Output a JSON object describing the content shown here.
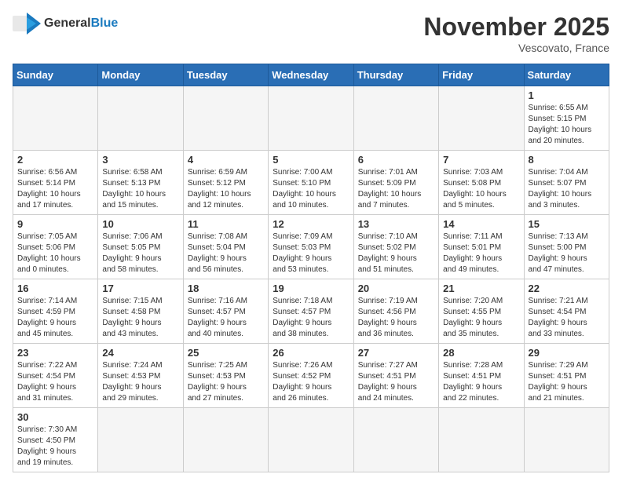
{
  "header": {
    "logo_text_normal": "General",
    "logo_text_blue": "Blue",
    "month_title": "November 2025",
    "location": "Vescovato, France"
  },
  "weekdays": [
    "Sunday",
    "Monday",
    "Tuesday",
    "Wednesday",
    "Thursday",
    "Friday",
    "Saturday"
  ],
  "weeks": [
    [
      {
        "day": "",
        "info": ""
      },
      {
        "day": "",
        "info": ""
      },
      {
        "day": "",
        "info": ""
      },
      {
        "day": "",
        "info": ""
      },
      {
        "day": "",
        "info": ""
      },
      {
        "day": "",
        "info": ""
      },
      {
        "day": "1",
        "info": "Sunrise: 6:55 AM\nSunset: 5:15 PM\nDaylight: 10 hours\nand 20 minutes."
      }
    ],
    [
      {
        "day": "2",
        "info": "Sunrise: 6:56 AM\nSunset: 5:14 PM\nDaylight: 10 hours\nand 17 minutes."
      },
      {
        "day": "3",
        "info": "Sunrise: 6:58 AM\nSunset: 5:13 PM\nDaylight: 10 hours\nand 15 minutes."
      },
      {
        "day": "4",
        "info": "Sunrise: 6:59 AM\nSunset: 5:12 PM\nDaylight: 10 hours\nand 12 minutes."
      },
      {
        "day": "5",
        "info": "Sunrise: 7:00 AM\nSunset: 5:10 PM\nDaylight: 10 hours\nand 10 minutes."
      },
      {
        "day": "6",
        "info": "Sunrise: 7:01 AM\nSunset: 5:09 PM\nDaylight: 10 hours\nand 7 minutes."
      },
      {
        "day": "7",
        "info": "Sunrise: 7:03 AM\nSunset: 5:08 PM\nDaylight: 10 hours\nand 5 minutes."
      },
      {
        "day": "8",
        "info": "Sunrise: 7:04 AM\nSunset: 5:07 PM\nDaylight: 10 hours\nand 3 minutes."
      }
    ],
    [
      {
        "day": "9",
        "info": "Sunrise: 7:05 AM\nSunset: 5:06 PM\nDaylight: 10 hours\nand 0 minutes."
      },
      {
        "day": "10",
        "info": "Sunrise: 7:06 AM\nSunset: 5:05 PM\nDaylight: 9 hours\nand 58 minutes."
      },
      {
        "day": "11",
        "info": "Sunrise: 7:08 AM\nSunset: 5:04 PM\nDaylight: 9 hours\nand 56 minutes."
      },
      {
        "day": "12",
        "info": "Sunrise: 7:09 AM\nSunset: 5:03 PM\nDaylight: 9 hours\nand 53 minutes."
      },
      {
        "day": "13",
        "info": "Sunrise: 7:10 AM\nSunset: 5:02 PM\nDaylight: 9 hours\nand 51 minutes."
      },
      {
        "day": "14",
        "info": "Sunrise: 7:11 AM\nSunset: 5:01 PM\nDaylight: 9 hours\nand 49 minutes."
      },
      {
        "day": "15",
        "info": "Sunrise: 7:13 AM\nSunset: 5:00 PM\nDaylight: 9 hours\nand 47 minutes."
      }
    ],
    [
      {
        "day": "16",
        "info": "Sunrise: 7:14 AM\nSunset: 4:59 PM\nDaylight: 9 hours\nand 45 minutes."
      },
      {
        "day": "17",
        "info": "Sunrise: 7:15 AM\nSunset: 4:58 PM\nDaylight: 9 hours\nand 43 minutes."
      },
      {
        "day": "18",
        "info": "Sunrise: 7:16 AM\nSunset: 4:57 PM\nDaylight: 9 hours\nand 40 minutes."
      },
      {
        "day": "19",
        "info": "Sunrise: 7:18 AM\nSunset: 4:57 PM\nDaylight: 9 hours\nand 38 minutes."
      },
      {
        "day": "20",
        "info": "Sunrise: 7:19 AM\nSunset: 4:56 PM\nDaylight: 9 hours\nand 36 minutes."
      },
      {
        "day": "21",
        "info": "Sunrise: 7:20 AM\nSunset: 4:55 PM\nDaylight: 9 hours\nand 35 minutes."
      },
      {
        "day": "22",
        "info": "Sunrise: 7:21 AM\nSunset: 4:54 PM\nDaylight: 9 hours\nand 33 minutes."
      }
    ],
    [
      {
        "day": "23",
        "info": "Sunrise: 7:22 AM\nSunset: 4:54 PM\nDaylight: 9 hours\nand 31 minutes."
      },
      {
        "day": "24",
        "info": "Sunrise: 7:24 AM\nSunset: 4:53 PM\nDaylight: 9 hours\nand 29 minutes."
      },
      {
        "day": "25",
        "info": "Sunrise: 7:25 AM\nSunset: 4:53 PM\nDaylight: 9 hours\nand 27 minutes."
      },
      {
        "day": "26",
        "info": "Sunrise: 7:26 AM\nSunset: 4:52 PM\nDaylight: 9 hours\nand 26 minutes."
      },
      {
        "day": "27",
        "info": "Sunrise: 7:27 AM\nSunset: 4:51 PM\nDaylight: 9 hours\nand 24 minutes."
      },
      {
        "day": "28",
        "info": "Sunrise: 7:28 AM\nSunset: 4:51 PM\nDaylight: 9 hours\nand 22 minutes."
      },
      {
        "day": "29",
        "info": "Sunrise: 7:29 AM\nSunset: 4:51 PM\nDaylight: 9 hours\nand 21 minutes."
      }
    ],
    [
      {
        "day": "30",
        "info": "Sunrise: 7:30 AM\nSunset: 4:50 PM\nDaylight: 9 hours\nand 19 minutes."
      },
      {
        "day": "",
        "info": ""
      },
      {
        "day": "",
        "info": ""
      },
      {
        "day": "",
        "info": ""
      },
      {
        "day": "",
        "info": ""
      },
      {
        "day": "",
        "info": ""
      },
      {
        "day": "",
        "info": ""
      }
    ]
  ]
}
